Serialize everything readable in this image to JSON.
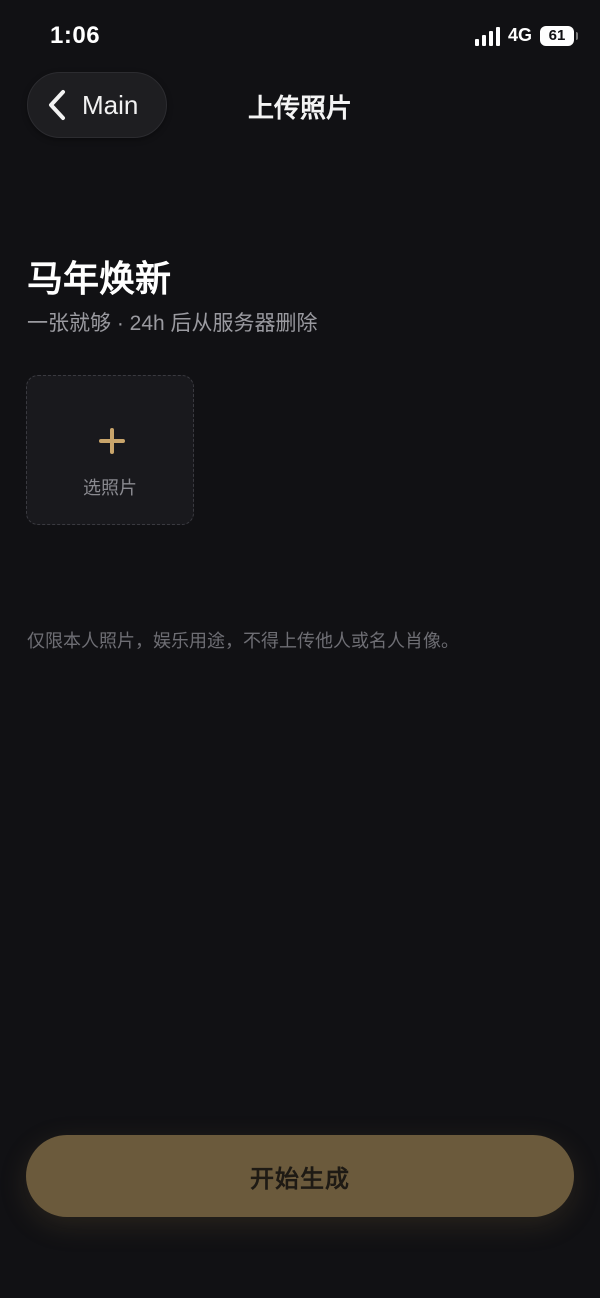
{
  "status_bar": {
    "time": "1:06",
    "network": "4G",
    "battery": "61",
    "signal_icon": "cellular-signal-icon",
    "battery_icon": "battery-icon"
  },
  "nav": {
    "back_label": "Main",
    "back_icon": "chevron-left-icon",
    "title": "上传照片"
  },
  "main": {
    "title": "马年焕新",
    "subtitle": "一张就够 · 24h 后从服务器删除",
    "upload": {
      "icon": "plus-icon",
      "label": "选照片"
    },
    "disclaimer": "仅限本人照片，娱乐用途，不得上传他人或名人肖像。"
  },
  "cta": {
    "label": "开始生成"
  },
  "colors": {
    "background": "#111114",
    "accent": "#c9a56b",
    "button": "#6b5a3c"
  }
}
